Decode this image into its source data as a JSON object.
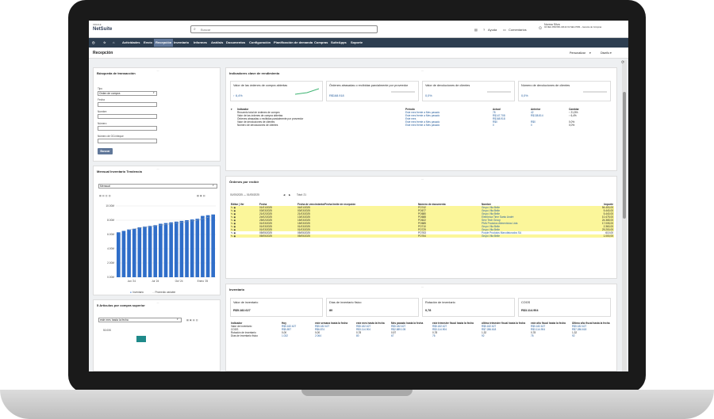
{
  "app": {
    "brand_top": "ORACLE",
    "brand": "NetSuite"
  },
  "topbar": {
    "search_placeholder": "Buscar",
    "help": "Ayuda",
    "comments": "Comentarios",
    "user_name": "Norma Silva",
    "user_detail": "02 NEG PRM BR-UM-02 02 NEG PRM – Gerente de Compras"
  },
  "nav": [
    "Actividades",
    "Envío",
    "Recepción",
    "Inventario",
    "Informes",
    "Análisis",
    "Documentos",
    "Configuración",
    "Planificación de demanda",
    "Compras",
    "SuiteApps",
    "Soporte"
  ],
  "page": {
    "title": "Recepción",
    "personalize": "Personalizar",
    "layout": "Diseño"
  },
  "search_panel": {
    "title": "Búsqueda de transacción",
    "fields": [
      {
        "label": "Tipo",
        "value": "Orden de compra"
      },
      {
        "label": "Fecha",
        "value": ""
      },
      {
        "label": "Nombre",
        "value": ""
      },
      {
        "label": "Número",
        "value": ""
      },
      {
        "label": "Número de OC/cheque",
        "value": ""
      }
    ],
    "button": "Buscar"
  },
  "trend_panel": {
    "title": "Mensual Inventario Tendencia",
    "selector": "Mensual",
    "legend": [
      "Inventario",
      "Promedio variable"
    ]
  },
  "chart_data": {
    "type": "bar",
    "ylabels": [
      "10.00M",
      "8.00M",
      "6.00M",
      "4.00M",
      "2.00M",
      "0.00M"
    ],
    "ylim": [
      0,
      10
    ],
    "xlabels": [
      "Jun '24",
      "Jul '24",
      "Oct '24",
      "Enero '25"
    ],
    "series": [
      {
        "name": "Inventario",
        "values": [
          6.3,
          6.5,
          6.7,
          6.8,
          7.0,
          7.1,
          7.2,
          7.3,
          7.5,
          7.6,
          7.7,
          7.8,
          7.9,
          8.0,
          8.1,
          8.2,
          8.6,
          8.7,
          8.8
        ]
      },
      {
        "name": "Promedio variable",
        "values": [
          null,
          null,
          6.6,
          6.8,
          6.9,
          7.0,
          7.1,
          7.2,
          7.3,
          7.4,
          7.5,
          7.6,
          7.7,
          7.8,
          7.9,
          8.0,
          8.2,
          8.4,
          8.6
        ]
      }
    ]
  },
  "top_panel": {
    "title": "5 Artículos por compra superior",
    "selector": "este mes hasta la fecha",
    "axis_label": "50.00K"
  },
  "kpi_panel": {
    "title": "Indicadores clave de rendimiento",
    "cards": [
      {
        "label": "Valor de las órdenes de compra abiertas",
        "value": "↑  6,4%"
      },
      {
        "label": "Órdenes atrasadas o recibidas parcialmente por proveedor",
        "value": "R$168.918"
      },
      {
        "label": "Valor de devoluciones de clientes",
        "value": "0,0%"
      },
      {
        "label": "Número de devoluciones de clientes",
        "value": "0,0%"
      }
    ],
    "headers": [
      "Indicador",
      "Período",
      "Actual",
      "Anterior",
      "Cambiar"
    ],
    "rows": [
      [
        "Recuento total de órdenes de compra",
        "Este mes frente a Mes pasado",
        "78",
        "42",
        "↑ 21,5%"
      ],
      [
        "Valor de las órdenes de compra abiertas",
        "Este mes frente a Mes pasado",
        "R$147.708",
        "R$138.814",
        "↑ 6,4%"
      ],
      [
        "Órdenes atrasadas o recibidas parcialmente por proveedor",
        "Este mes",
        "R$168.918",
        "",
        ""
      ],
      [
        "Valor de devoluciones de clientes",
        "Este mes frente a Mes pasado",
        "R$0",
        "R$0",
        "0,0%"
      ],
      [
        "Número de devoluciones de clientes",
        "Este mes frente a Mes pasado",
        "0",
        "0",
        "0,0%"
      ]
    ]
  },
  "orders_panel": {
    "title": "Órdenes por recibir",
    "date_range": "01/05/2025 — 01/05/2025",
    "total": "Total: 21",
    "headers": [
      "Editar | Ver",
      "Fecha",
      "Fecha de vencimiento/Fecha límite de recepción",
      "Número de documento",
      "Nombre",
      "Importe"
    ],
    "rows": [
      [
        "01/01/2025",
        "04/01/2025",
        "PO742",
        "Grupo Vila Belle",
        "54.400,00"
      ],
      [
        "03/03/2025",
        "03/03/2025",
        "PO677",
        "Grupo Vila Belle",
        "5.440,00"
      ],
      [
        "21/02/2025",
        "21/03/2025",
        "PO680",
        "Grupo Vila Belle",
        "5.440,00"
      ],
      [
        "24/02/2025",
        "13/03/2025",
        "PO688",
        "Eletrônica Time Santo André",
        "10.475,00"
      ],
      [
        "25/02/2025",
        "15/03/2025",
        "PO622",
        "Serv Tech Group",
        "24.365,00"
      ],
      [
        "01/03/2025",
        "15/03/2025",
        "PO685",
        "PMA Produtos Alimentícios Ltda",
        "17.005,00"
      ],
      [
        "01/03/2025",
        "01/03/2025",
        "PO710",
        "Grupo Vila Belle",
        "2.360,00"
      ],
      [
        "01/03/2025",
        "01/03/2025",
        "PO729",
        "Grupo Vila Belle",
        "29.200,00"
      ],
      [
        "05/05/2025",
        "05/05/2025",
        "PO763",
        "Purple Produtos Manufaturados SA",
        "610,00"
      ],
      [
        "05/05/2025",
        "05/05/2025",
        "PO764",
        "Grupo Vila Belle",
        "1.000,00"
      ]
    ]
  },
  "inventory_panel": {
    "title": "Inventario",
    "cards": [
      {
        "label": "Valor de inventario",
        "value": "R$5.182.627"
      },
      {
        "label": "Días de inventario físico",
        "value": "80"
      },
      {
        "label": "Rotación de inventario",
        "value": "0,78"
      },
      {
        "label": "COGS",
        "value": "R$3.114.904"
      }
    ],
    "headers": [
      "Indicador",
      "Hoy",
      "este semana hasta la fecha",
      "este mes hasta la fecha",
      "Mes pasado hasta la fecha",
      "este trimestre fiscal hasta la fecha",
      "último trimestre fiscal hasta la fecha",
      "este año fiscal hasta la fecha",
      "Último año fiscal hasta la fecha"
    ],
    "rows": [
      [
        "Valor de inventario",
        "R$5.182.627",
        "R$5.182.627",
        "R$5.182.627",
        "R$5.182.627",
        "R$5.182.627",
        "R$5.182.627",
        "R$5.182.627",
        "R$5.182.627"
      ],
      [
        "COGS",
        "R$5.897",
        "R$6.874",
        "R$3.114.904",
        "R$2.889.105",
        "R$3.114.904",
        "R$7.286.618",
        "R$3.114.904",
        "R$7.286.618"
      ],
      [
        "Rotación de inventario",
        "0,00",
        "0,00",
        "0,78",
        "0,57",
        "0,78",
        "1,32",
        "0,78",
        "1,32"
      ],
      [
        "Días de inventario físico",
        "1.032",
        "2.064",
        "80",
        "67",
        "76",
        "92",
        "76",
        "92"
      ]
    ]
  }
}
